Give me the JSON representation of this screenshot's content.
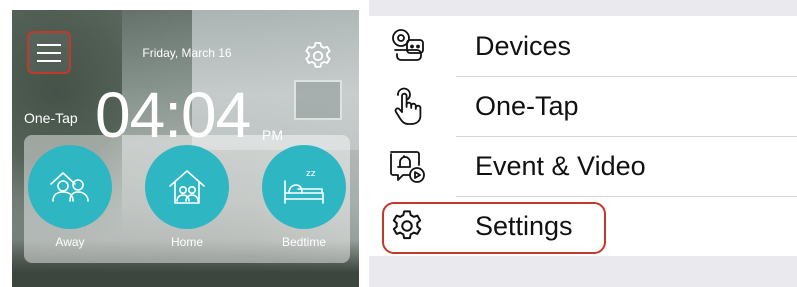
{
  "home_screen": {
    "date": "Friday, March 16",
    "one_tap_label": "One-Tap",
    "time": "04:04",
    "ampm": "PM",
    "modes": [
      {
        "label": "Away",
        "icon": "away-people-icon"
      },
      {
        "label": "Home",
        "icon": "home-house-icon"
      },
      {
        "label": "Bedtime",
        "icon": "bedtime-bed-icon"
      }
    ],
    "colors": {
      "mode_circle": "#2fb6c3",
      "highlight": "#c0392b"
    },
    "icons": {
      "menu": "hamburger-menu-icon",
      "settings": "gear-icon"
    }
  },
  "side_menu": {
    "items": [
      {
        "label": "Devices",
        "icon": "devices-icon"
      },
      {
        "label": "One-Tap",
        "icon": "tap-hand-icon"
      },
      {
        "label": "Event & Video",
        "icon": "event-video-icon"
      },
      {
        "label": "Settings",
        "icon": "gear-icon",
        "highlighted": true
      }
    ]
  }
}
